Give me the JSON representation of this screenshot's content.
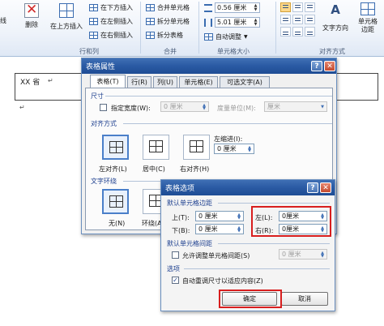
{
  "ribbon": {
    "partial_left_label": "线",
    "delete_label": "删除",
    "insert_above_label": "在上方插入",
    "insert_below_label": "在下方插入",
    "insert_left_label": "在左侧插入",
    "insert_right_label": "在右侧插入",
    "rows_cols_group": "行和列",
    "merge_cells_label": "合并单元格",
    "split_cells_label": "拆分单元格",
    "split_table_label": "拆分表格",
    "merge_group": "合并",
    "height_value": "0.56 厘米",
    "width_value": "5.01 厘米",
    "autofit_label": "自动调整",
    "cell_size_group": "单元格大小",
    "text_direction_label": "文字方向",
    "cell_margins_label": "单元格边距",
    "align_group": "对齐方式"
  },
  "document": {
    "cell_text": "XX 省",
    "para_mark": "↵"
  },
  "table_props": {
    "title": "表格属性",
    "help": "?",
    "close": "✕",
    "tabs": [
      "表格(T)",
      "行(R)",
      "列(U)",
      "单元格(E)",
      "可选文字(A)"
    ],
    "size_section": "尺寸",
    "pref_width_label": "指定宽度(W):",
    "pref_width_value": "0 厘米",
    "measure_label": "度量单位(M):",
    "measure_value": "厘米",
    "align_section": "对齐方式",
    "align_left": "左对齐(L)",
    "align_center": "居中(C)",
    "align_right": "右对齐(H)",
    "indent_label": "左缩进(I):",
    "indent_value": "0 厘米",
    "wrap_section": "文字环绕",
    "wrap_none": "无(N)",
    "wrap_around": "环绕(A)"
  },
  "table_options": {
    "title": "表格选项",
    "help": "?",
    "close": "✕",
    "margins_section": "默认单元格边距",
    "top_label": "上(T):",
    "top_value": "0 厘米",
    "bottom_label": "下(B):",
    "bottom_value": "0 厘米",
    "left_label": "左(L):",
    "left_value": "0厘米",
    "right_label": "右(R):",
    "right_value": "0厘米",
    "spacing_section": "默认单元格间距",
    "allow_spacing_label": "允许调整单元格间距(S)",
    "spacing_value": "0 厘米",
    "options_section": "选项",
    "autoresize_label": "自动重调尺寸以适应内容(Z)",
    "ok_label": "确定",
    "cancel_label": "取消"
  },
  "colors": {
    "titlebar": "#2a5aa3",
    "highlight": "#d81e1e",
    "selected_option": "#4a7fc9"
  }
}
